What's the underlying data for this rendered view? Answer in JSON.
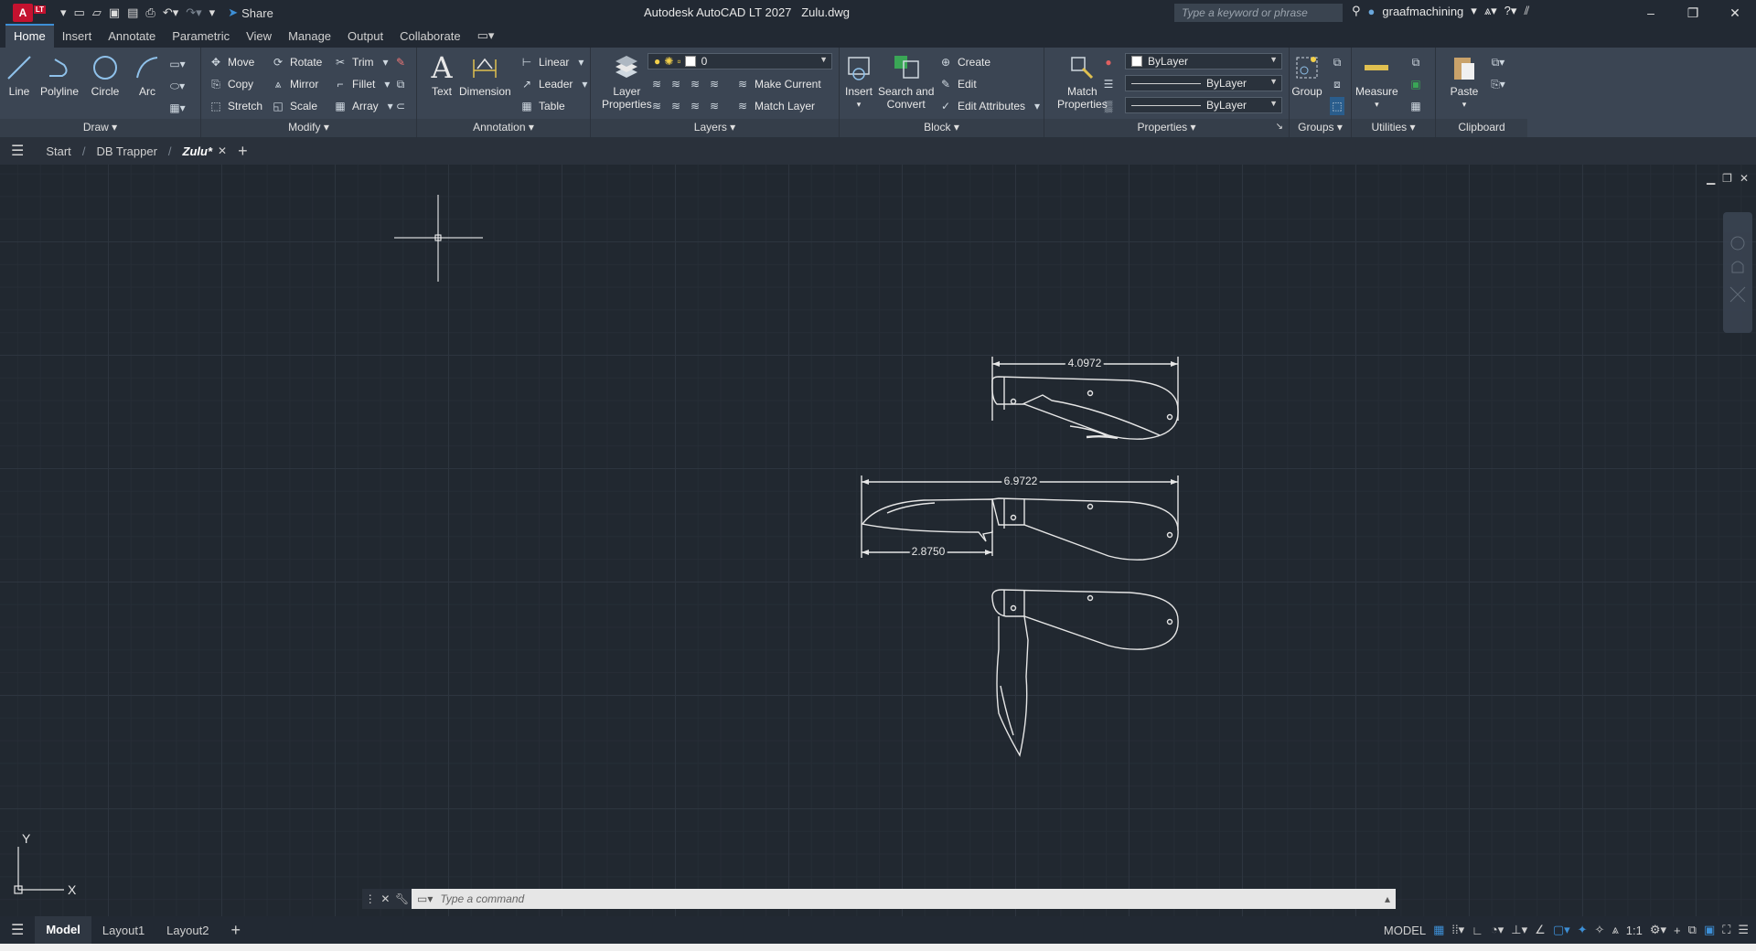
{
  "titlebar": {
    "logo": "A",
    "logo_sub": "LT",
    "share_label": "Share",
    "title": "Autodesk AutoCAD LT 2027   Zulu.dwg",
    "search_placeholder": "Type a keyword or phrase",
    "username": "graafmachining"
  },
  "ribbon_tabs": [
    "Home",
    "Insert",
    "Annotate",
    "Parametric",
    "View",
    "Manage",
    "Output",
    "Collaborate"
  ],
  "draw": {
    "label": "Draw",
    "line": "Line",
    "polyline": "Polyline",
    "circle": "Circle",
    "arc": "Arc"
  },
  "modify": {
    "label": "Modify",
    "move": "Move",
    "rotate": "Rotate",
    "trim": "Trim",
    "copy": "Copy",
    "mirror": "Mirror",
    "fillet": "Fillet",
    "stretch": "Stretch",
    "scale": "Scale",
    "array": "Array"
  },
  "annotation": {
    "label": "Annotation",
    "text": "Text",
    "dimension": "Dimension",
    "linear": "Linear",
    "leader": "Leader",
    "table": "Table"
  },
  "layers": {
    "label": "Layers",
    "layer_properties": "Layer\nProperties",
    "current_layer": "0",
    "make_current": "Make Current",
    "match_layer": "Match Layer"
  },
  "block": {
    "label": "Block",
    "insert": "Insert",
    "search_convert": "Search and\nConvert",
    "create": "Create",
    "edit": "Edit",
    "edit_attributes": "Edit Attributes"
  },
  "properties": {
    "label": "Properties",
    "match_properties": "Match\nProperties",
    "color": "ByLayer",
    "linetype": "ByLayer",
    "lineweight": "ByLayer"
  },
  "groups": {
    "label": "Groups",
    "group": "Group"
  },
  "utilities": {
    "label": "Utilities",
    "measure": "Measure"
  },
  "clipboard": {
    "label": "Clipboard",
    "paste": "Paste"
  },
  "file_tabs": [
    "Start",
    "DB Trapper",
    "Zulu*"
  ],
  "drawing": {
    "dim_top": "4.0972",
    "dim_overall": "6.9722",
    "dim_blade": "2.8750",
    "ucs_x": "X",
    "ucs_y": "Y"
  },
  "command": {
    "placeholder": "Type a command"
  },
  "layout_tabs": [
    "Model",
    "Layout1",
    "Layout2"
  ],
  "status": {
    "model": "MODEL",
    "scale": "1:1"
  }
}
